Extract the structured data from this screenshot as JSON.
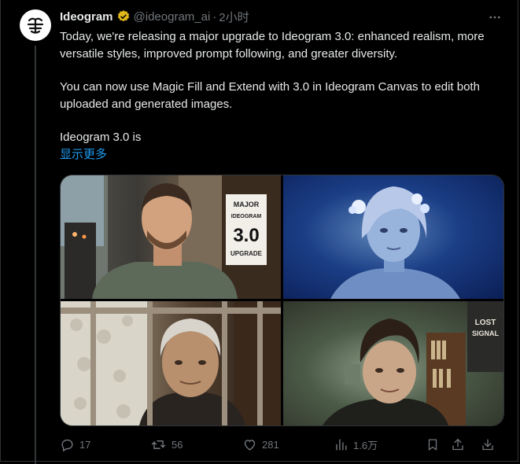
{
  "tweet": {
    "display_name": "Ideogram",
    "handle": "@ideogram_ai",
    "separator": "·",
    "time": "2小时",
    "paragraph1": "Today, we're releasing a major upgrade to Ideogram 3.0: enhanced realism, more versatile styles, improved prompt following, and greater diversity.",
    "paragraph2": "You can now use Magic Fill and Extend with 3.0 in Ideogram Canvas to edit both uploaded and generated images.",
    "paragraph3": "Ideogram 3.0 is",
    "show_more": "显示更多"
  },
  "media": {
    "sign_lines": [
      "MAJOR",
      "IDEOGRAM",
      "3.0",
      "UPGRADE"
    ],
    "poster_lines": [
      "LOST",
      "SIGNAL"
    ]
  },
  "actions": {
    "reply_count": "17",
    "retweet_count": "56",
    "like_count": "281",
    "views_count": "1.6万"
  },
  "colors": {
    "background": "#000000",
    "text": "#e7e9ea",
    "muted": "#71767b",
    "link": "#1d9bf0",
    "verified_gold": "#e2b719"
  },
  "icons": [
    "logo-icon",
    "verified-badge-icon",
    "more-icon",
    "reply-icon",
    "retweet-icon",
    "like-icon",
    "views-icon",
    "bookmark-icon",
    "share-icon",
    "download-icon"
  ]
}
